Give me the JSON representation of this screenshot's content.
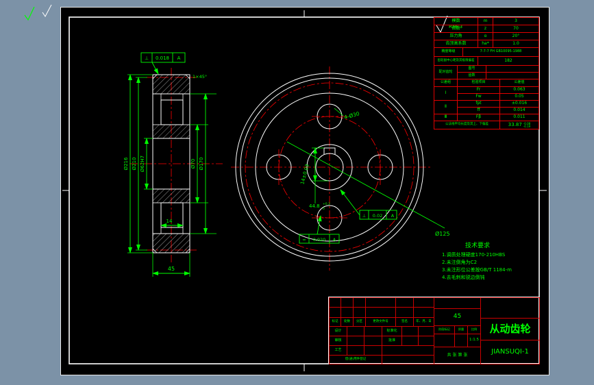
{
  "window": {
    "bg": "#7C92A7"
  },
  "marks": {
    "roughness": "Ra6.3"
  },
  "section_view": {
    "tol_sym": "⊥",
    "tol_val": "0.018",
    "tol_datum": "A",
    "chamfer": "1×45°",
    "dia_outer": "Ø216",
    "dia_pitch": "Ø210",
    "dia_bore": "Ø62H7",
    "dia_hub": "Ø70",
    "dia_web": "Ø170",
    "width": "45",
    "rim_width": "14"
  },
  "front_view": {
    "holes_label": "4-Ø30",
    "bolt_circle": "Ø125",
    "keyway_width": "14±0.03",
    "keyway_height": "44.8",
    "kh_sup": "+0.2",
    "kh_sub": "0",
    "tol1_sym": "=",
    "tol1_val": "0.020",
    "tol1_datum": "A",
    "tol2_sym": "⊥",
    "tol2_val": "0.02",
    "tol2_datum": "A"
  },
  "tech_req": {
    "title": "技术要求",
    "line1": "1.调质处理硬度170-210HBS",
    "line2": "2.未注倒角为C2",
    "line3": "3.未注形位公差按GB/T 1184-m",
    "line4": "4.去毛刺和锐边倒钝"
  },
  "param_table": {
    "r1_label": "模数",
    "r1_sym": "m",
    "r1_val": "3",
    "r2_label": "齿数",
    "r2_sym": "z",
    "r2_val": "70",
    "r3_label": "压力角",
    "r3_sym": "α",
    "r3_val": "20°",
    "r4_label": "齿顶高系数",
    "r4_sym": "ha*",
    "r4_val": "1.0",
    "r5_label": "精度等级",
    "r5_val": "7-7-7 FH GB10095-1988",
    "r6_label": "齿轮副中心距及其极限偏差",
    "r6_val": "182",
    "r7_label": "配对齿轮",
    "r7a": "图号",
    "r7b": "齿数",
    "hdr_group": "公差组",
    "hdr_item": "检验项目",
    "hdr_val": "公差值",
    "g1": "Ⅰ",
    "g1r1_code": "Fr",
    "g1r1_val": "0.063",
    "g1r2_code": "Fw",
    "g1r2_val": "0.05",
    "g2": "Ⅱ",
    "g2r1_code": "fpt",
    "g2r1_val": "±0.016",
    "g2r2_code": "ff",
    "g2r2_val": "0.014",
    "g3": "Ⅲ",
    "g3r1_code": "Fβ",
    "g3r1_val": "0.011",
    "w_label": "公法线平均长度及其上、下偏差",
    "w_val": "33.87",
    "w_sup": "-0.08",
    "w_sub": "-0.19"
  },
  "title_block": {
    "hdr0": "标记",
    "hdr1": "处数",
    "hdr2": "分区",
    "hdr3": "更改文件号",
    "hdr4": "签名",
    "hdr5": "年、月、日",
    "role_design": "设计",
    "role_check": "审核",
    "role_process": "工艺",
    "role_borrow": "借(通)用件登记",
    "role_std": "标准化",
    "role_approve": "批准",
    "stage": "阶段标记",
    "weight": "质量",
    "scale_label": "比例",
    "scale_val": "1:1.5",
    "material": "45",
    "sheets": "共 张 第 张",
    "part_name": "从动齿轮",
    "drawing_no": "JIANSUQI-1"
  }
}
